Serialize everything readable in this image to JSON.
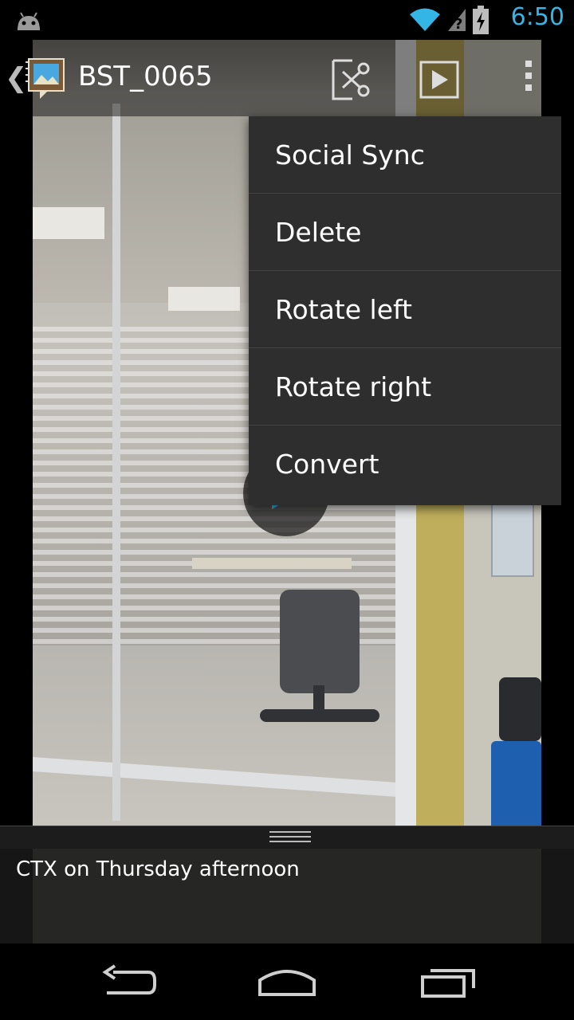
{
  "status_bar": {
    "time": "6:50",
    "icons": [
      "android-debug-icon",
      "wifi-icon",
      "no-signal-icon",
      "battery-charging-icon"
    ]
  },
  "action_bar": {
    "title": "BST_0065",
    "icons": [
      "back-chevron-icon",
      "gallery-app-icon",
      "trim-video-icon",
      "play-icon",
      "overflow-menu-icon"
    ]
  },
  "menu": {
    "items": [
      {
        "label": "Social Sync"
      },
      {
        "label": "Delete"
      },
      {
        "label": "Rotate left"
      },
      {
        "label": "Rotate right"
      },
      {
        "label": "Convert"
      }
    ]
  },
  "caption": {
    "text": "CTX on Thursday afternoon"
  },
  "nav_bar": {
    "icons": [
      "back-icon",
      "home-icon",
      "recent-apps-icon"
    ]
  },
  "colors": {
    "accent": "#33b5e5",
    "menu_bg": "#2e2e2e"
  }
}
